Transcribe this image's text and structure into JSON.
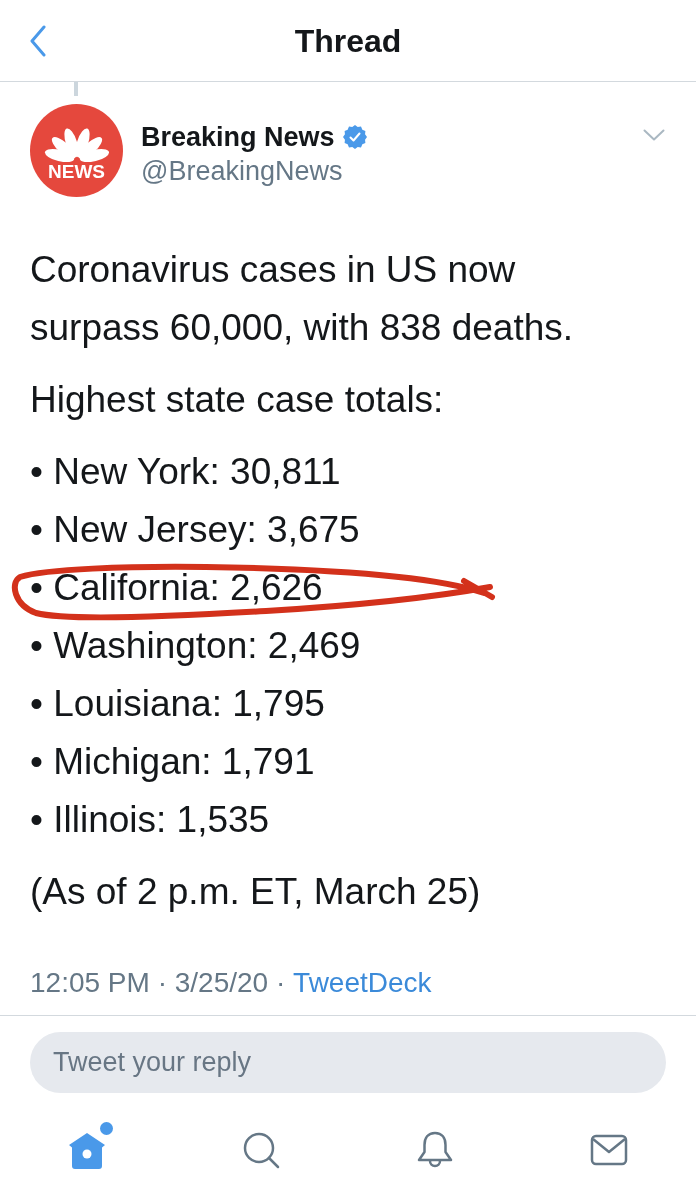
{
  "header": {
    "title": "Thread"
  },
  "tweet": {
    "author": {
      "name": "Breaking News",
      "verified": true,
      "handle": "@BreakingNews",
      "avatar_label": "NEWS"
    },
    "text": "Coronavirus cases in US now surpass 60,000, with 838 deaths.",
    "list_heading": "Highest state case totals:",
    "state_totals": [
      {
        "text": "• New York: 30,811",
        "circled": false
      },
      {
        "text": "• New Jersey: 3,675",
        "circled": false
      },
      {
        "text": "• California: 2,626",
        "circled": true
      },
      {
        "text": "• Washington: 2,469",
        "circled": false
      },
      {
        "text": "• Louisiana: 1,795",
        "circled": false
      },
      {
        "text": "• Michigan: 1,791",
        "circled": false
      },
      {
        "text": "• Illinois: 1,535",
        "circled": false
      }
    ],
    "note": "(As of 2 p.m. ET, March 25)",
    "meta": {
      "timestamp": "12:05 PM · 3/25/20 ·",
      "source": "TweetDeck"
    }
  },
  "reply": {
    "placeholder": "Tweet your reply"
  },
  "tab_bar": [
    {
      "kind": "home",
      "selected": true,
      "badge": true
    },
    {
      "kind": "search",
      "selected": false,
      "badge": false
    },
    {
      "kind": "notifications",
      "selected": false,
      "badge": false
    },
    {
      "kind": "messages",
      "selected": false,
      "badge": false
    }
  ]
}
